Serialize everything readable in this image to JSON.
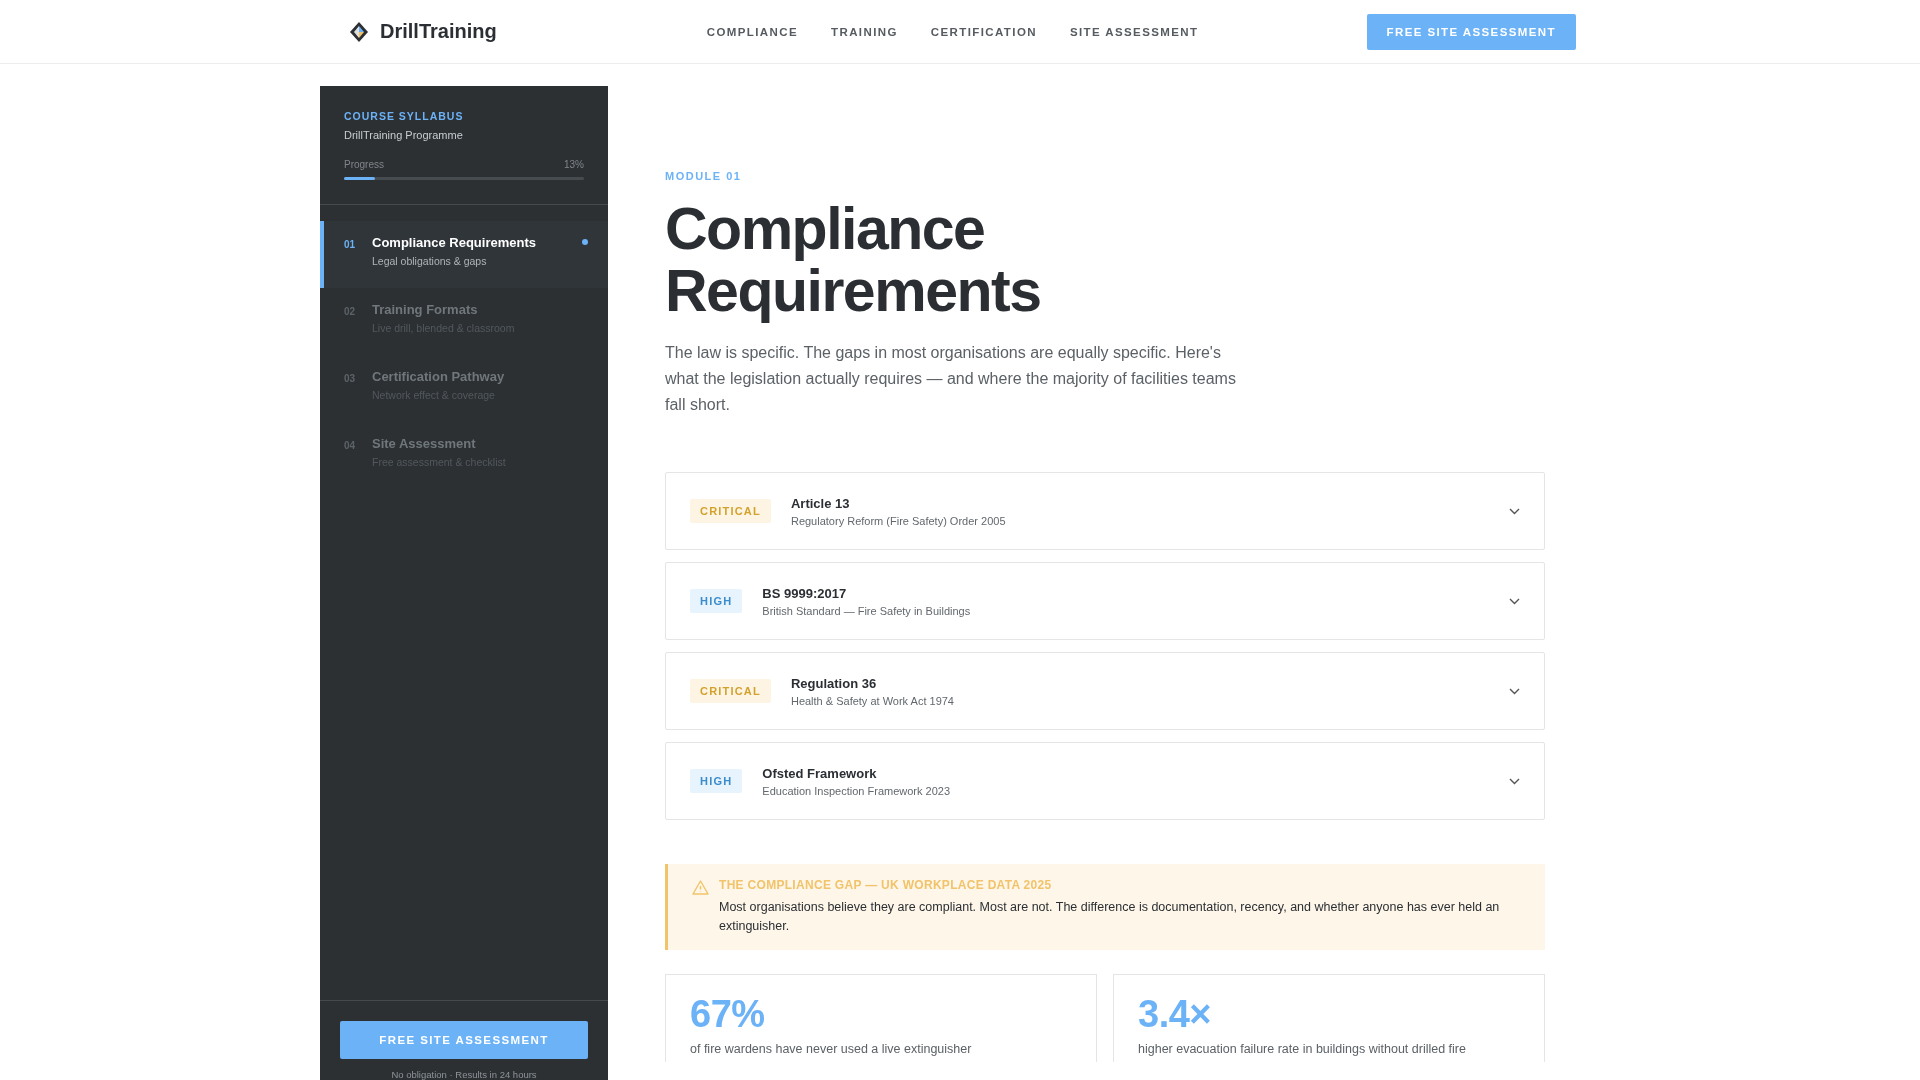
{
  "header": {
    "brand": "DrillTraining",
    "nav": [
      "COMPLIANCE",
      "TRAINING",
      "CERTIFICATION",
      "SITE ASSESSMENT"
    ],
    "cta": "FREE SITE ASSESSMENT"
  },
  "sidebar": {
    "eyebrow": "COURSE SYLLABUS",
    "programme": "DrillTraining Programme",
    "progress_label": "Progress",
    "progress_reading": "13%",
    "level": 0.13,
    "items": [
      {
        "number": "01",
        "title": "Compliance Requirements",
        "subtitle": "Legal obligations & gaps",
        "selected": true
      },
      {
        "number": "02",
        "title": "Training Formats",
        "subtitle": "Live drill, blended & classroom",
        "selected": false
      },
      {
        "number": "03",
        "title": "Certification Pathway",
        "subtitle": "Network effect & coverage",
        "selected": false
      },
      {
        "number": "04",
        "title": "Site Assessment",
        "subtitle": "Free assessment & checklist",
        "selected": false
      }
    ],
    "cta": "FREE SITE ASSESSMENT",
    "note": "No obligation · Results in 24 hours"
  },
  "main": {
    "eyebrow": "MODULE 01",
    "title": "Compliance Requirements",
    "intro": "The law is specific. The gaps in most organisations are equally specific. Here's what the legislation actually requires — and where the majority of facilities teams fall short.",
    "requirements": [
      {
        "kind": "critical",
        "badge": "CRITICAL",
        "title": "Article 13",
        "subtitle": "Regulatory Reform (Fire Safety) Order 2005"
      },
      {
        "kind": "high",
        "badge": "HIGH",
        "title": "BS 9999:2017",
        "subtitle": "British Standard — Fire Safety in Buildings"
      },
      {
        "kind": "critical",
        "badge": "CRITICAL",
        "title": "Regulation 36",
        "subtitle": "Health & Safety at Work Act 1974"
      },
      {
        "kind": "high",
        "badge": "HIGH",
        "title": "Ofsted Framework",
        "subtitle": "Education Inspection Framework 2023"
      }
    ],
    "callout": {
      "title": "THE COMPLIANCE GAP — UK WORKPLACE DATA 2025",
      "body": "Most organisations believe they are compliant. Most are not. The difference is documentation, recency, and whether anyone has ever held an extinguisher."
    },
    "stats": [
      {
        "value": "67%",
        "text": "of fire wardens have never used a live extinguisher"
      },
      {
        "value": "3.4×",
        "text": "higher evacuation failure rate in buildings without drilled fire"
      }
    ]
  }
}
